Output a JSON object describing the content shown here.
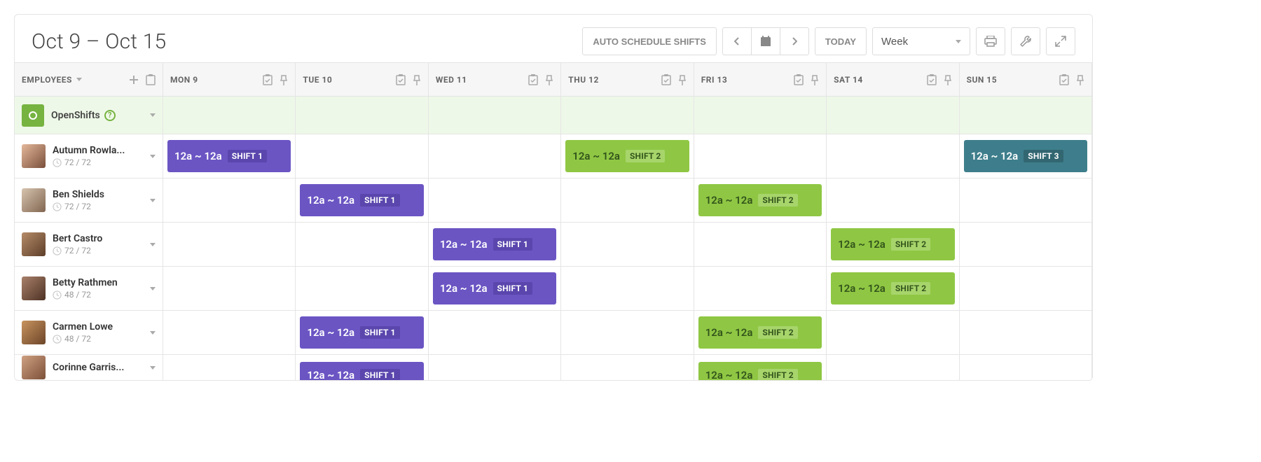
{
  "header": {
    "date_range": "Oct 9 – Oct 15",
    "auto_schedule": "AUTO SCHEDULE SHIFTS",
    "today": "TODAY",
    "view": "Week"
  },
  "columns": {
    "employees": "EMPLOYEES",
    "days": [
      "MON 9",
      "TUE 10",
      "WED 11",
      "THU 12",
      "FRI 13",
      "SAT 14",
      "SUN 15"
    ]
  },
  "open_shifts": {
    "label": "OpenShifts"
  },
  "shift_labels": {
    "time": "12a ~ 12a",
    "s1": "SHIFT 1",
    "s2": "SHIFT 2",
    "s3": "SHIFT 3"
  },
  "employees": [
    {
      "name": "Autumn Rowla...",
      "hours": "72  /  72",
      "shifts": [
        "s1",
        "",
        "",
        "s2",
        "",
        "",
        "s3"
      ]
    },
    {
      "name": "Ben Shields",
      "hours": "72  /  72",
      "shifts": [
        "",
        "s1",
        "",
        "",
        "s2",
        "",
        ""
      ]
    },
    {
      "name": "Bert Castro",
      "hours": "72  /  72",
      "shifts": [
        "",
        "",
        "s1",
        "",
        "",
        "s2",
        ""
      ]
    },
    {
      "name": "Betty Rathmen",
      "hours": "48  /  72",
      "shifts": [
        "",
        "",
        "s1",
        "",
        "",
        "s2",
        ""
      ]
    },
    {
      "name": "Carmen Lowe",
      "hours": "48  /  72",
      "shifts": [
        "",
        "s1",
        "",
        "",
        "s2",
        "",
        ""
      ]
    },
    {
      "name": "Corinne Garris...",
      "hours": "",
      "shifts": [
        "",
        "s1",
        "",
        "",
        "s2",
        "",
        ""
      ]
    }
  ]
}
